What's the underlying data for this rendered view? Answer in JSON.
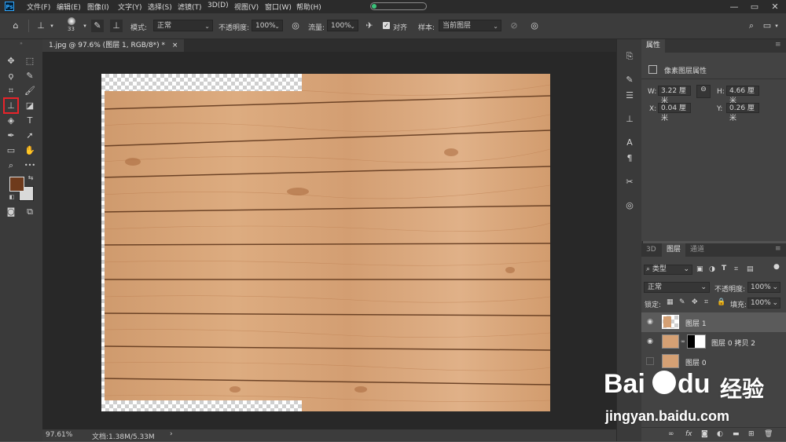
{
  "menu": {
    "app_icon": "Ps",
    "items": [
      "文件(F)",
      "编辑(E)",
      "图像(I)",
      "文字(Y)",
      "选择(S)",
      "滤镜(T)",
      "3D(D)",
      "视图(V)",
      "窗口(W)",
      "帮助(H)"
    ]
  },
  "window_controls": {
    "minimize": "—",
    "maximize": "▭",
    "close": "✕"
  },
  "options": {
    "brush_size": "33",
    "mode_label": "模式:",
    "mode_value": "正常",
    "opacity_label": "不透明度:",
    "opacity_value": "100%",
    "flow_label": "流量:",
    "flow_value": "100%",
    "aligned_label": "对齐",
    "sample_label": "样本:",
    "sample_value": "当前图层"
  },
  "document_tab": {
    "label": "1.jpg @ 97.6% (图层 1, RGB/8*) *",
    "close": "×"
  },
  "status": {
    "zoom": "97.61%",
    "doc_info": "文档:1.38M/5.33M",
    "arrow": "›"
  },
  "tools": [
    {
      "name": "move-tool-icon",
      "glyph": "✥"
    },
    {
      "name": "marquee-tool-icon",
      "glyph": "⬚"
    },
    {
      "name": "lasso-tool-icon",
      "glyph": "ϙ"
    },
    {
      "name": "quick-select-tool-icon",
      "glyph": "✎"
    },
    {
      "name": "crop-tool-icon",
      "glyph": "⌗"
    },
    {
      "name": "brush-tool-icon",
      "glyph": "🖌"
    },
    {
      "name": "clone-stamp-tool-icon",
      "glyph": "⊥"
    },
    {
      "name": "eraser-tool-icon",
      "glyph": "◪"
    },
    {
      "name": "paint-bucket-tool-icon",
      "glyph": "◈"
    },
    {
      "name": "type-tool-icon",
      "glyph": "T"
    },
    {
      "name": "pen-tool-icon",
      "glyph": "✒"
    },
    {
      "name": "path-select-tool-icon",
      "glyph": "➚"
    },
    {
      "name": "rectangle-tool-icon",
      "glyph": "▭"
    },
    {
      "name": "hand-tool-icon",
      "glyph": "✋"
    },
    {
      "name": "zoom-tool-icon",
      "glyph": "⌕"
    },
    {
      "name": "more-tools-icon",
      "glyph": "•••"
    }
  ],
  "colors": {
    "foreground": "#6e3a1c",
    "background": "#d9d9d9",
    "highlight": "#e8232a",
    "wood": "#d4a074"
  },
  "properties": {
    "tab": "属性",
    "subtitle": "像素图层属性",
    "w_label": "W:",
    "w_value": "3.22 厘米",
    "h_label": "H:",
    "h_value": "4.66 厘米",
    "x_label": "X:",
    "x_value": "0.04 厘米",
    "y_label": "Y:",
    "y_value": "0.26 厘米"
  },
  "layers_panel": {
    "tabs": [
      "3D",
      "图层",
      "通道"
    ],
    "filter_label": "类型",
    "blend_mode": "正常",
    "opacity_label": "不透明度:",
    "opacity_value": "100%",
    "lock_label": "锁定:",
    "fill_label": "填充:",
    "fill_value": "100%",
    "layers": [
      {
        "name": "图层 1",
        "visible": true,
        "selected": true
      },
      {
        "name": "图层 0 拷贝 2",
        "visible": true,
        "selected": false
      },
      {
        "name": "图层 0",
        "visible": false,
        "selected": false
      }
    ],
    "bottom_icons": [
      "link-icon",
      "fx-icon",
      "mask-icon",
      "adjustment-icon",
      "group-icon",
      "new-layer-icon",
      "trash-icon"
    ]
  },
  "watermark": {
    "brand": "Bai",
    "brand2": "du",
    "cn": "经验",
    "url": "jingyan.baidu.com"
  }
}
